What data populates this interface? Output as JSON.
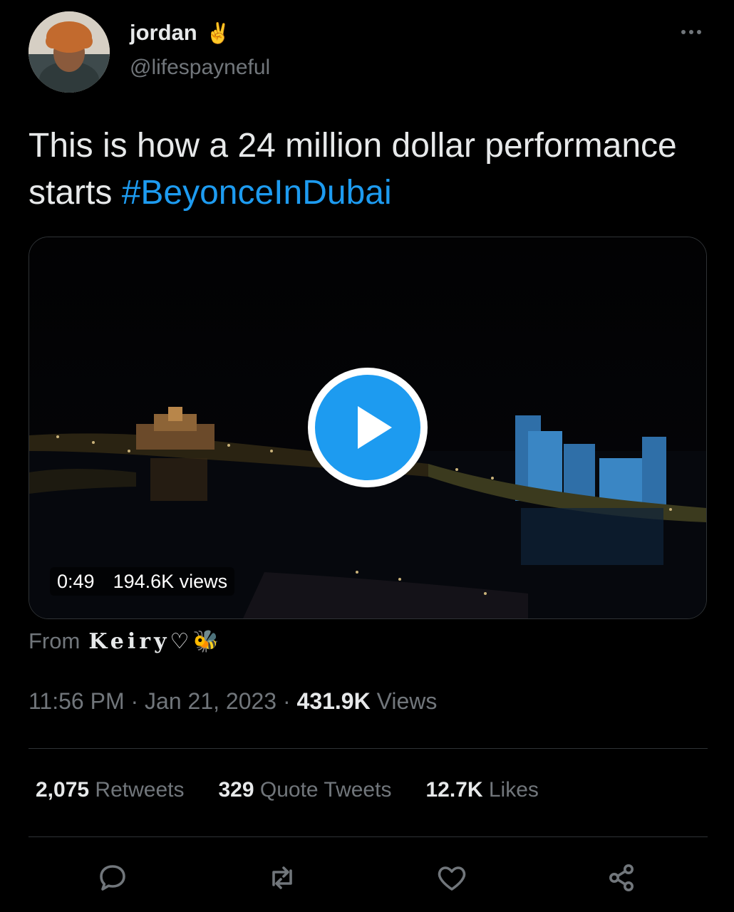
{
  "user": {
    "display_name": "jordan",
    "name_emoji": "✌️",
    "handle": "@lifespayneful"
  },
  "tweet": {
    "text": "This is how a 24 million dollar performance starts ",
    "hashtag": "#BeyonceInDubai"
  },
  "video": {
    "duration": "0:49",
    "views": "194.6K views"
  },
  "source": {
    "prefix": "From",
    "name": "Keiry♡🐝"
  },
  "meta": {
    "time": "11:56 PM",
    "date": "Jan 21, 2023",
    "views_count": "431.9K",
    "views_label": "Views",
    "separator": "·"
  },
  "stats": {
    "retweets_count": "2,075",
    "retweets_label": "Retweets",
    "quotes_count": "329",
    "quotes_label": "Quote Tweets",
    "likes_count": "12.7K",
    "likes_label": "Likes"
  },
  "colors": {
    "accent": "#1d9bf0",
    "background": "#000000",
    "muted": "#71767b"
  },
  "icons": [
    "more-icon",
    "play-icon",
    "reply-icon",
    "retweet-icon",
    "like-icon",
    "share-icon"
  ]
}
